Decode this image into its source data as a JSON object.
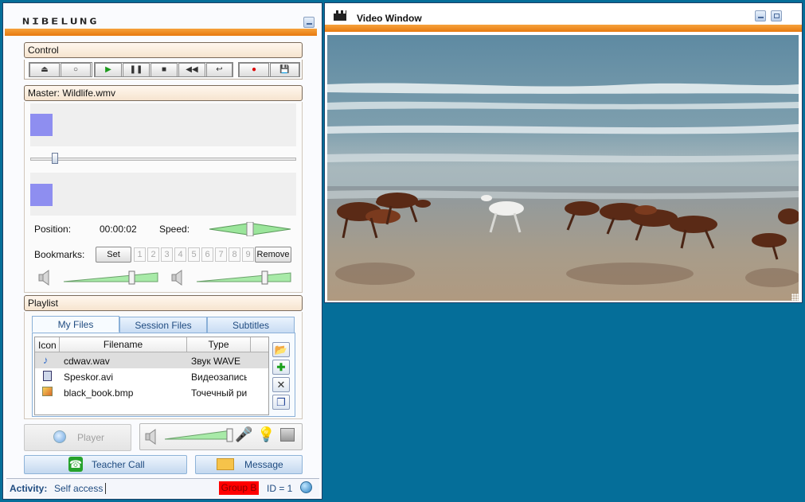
{
  "app": {
    "logo": "NIBELUNG"
  },
  "control": {
    "title": "Control"
  },
  "master": {
    "title": "Master: Wildlife.wmv",
    "position_label": "Position:",
    "position_value": "00:00:02",
    "speed_label": "Speed:",
    "bookmarks_label": "Bookmarks:",
    "set_label": "Set",
    "remove_label": "Remove",
    "bookmark_numbers": [
      "1",
      "2",
      "3",
      "4",
      "5",
      "6",
      "7",
      "8",
      "9"
    ]
  },
  "playlist": {
    "title": "Playlist",
    "tabs": [
      "My Files",
      "Session Files",
      "Subtitles"
    ],
    "columns": [
      "Icon",
      "Filename",
      "Type"
    ],
    "rows": [
      {
        "filename": "cdwav.wav",
        "type": "Звук WAVE"
      },
      {
        "filename": "Speskor.avi",
        "type": "Видеозапись"
      },
      {
        "filename": "black_book.bmp",
        "type": "Точечный ри"
      }
    ]
  },
  "bottom": {
    "player_label": "Player",
    "teacher_call_label": "Teacher Call",
    "message_label": "Message"
  },
  "status": {
    "activity_label": "Activity:",
    "activity_value": "Self access",
    "group_label": "Group B",
    "id_label": "ID = 1"
  },
  "video": {
    "title": "Video Window"
  },
  "colors": {
    "accent": "#ee8416",
    "background": "#056e99",
    "group_badge": "#ff0000"
  }
}
